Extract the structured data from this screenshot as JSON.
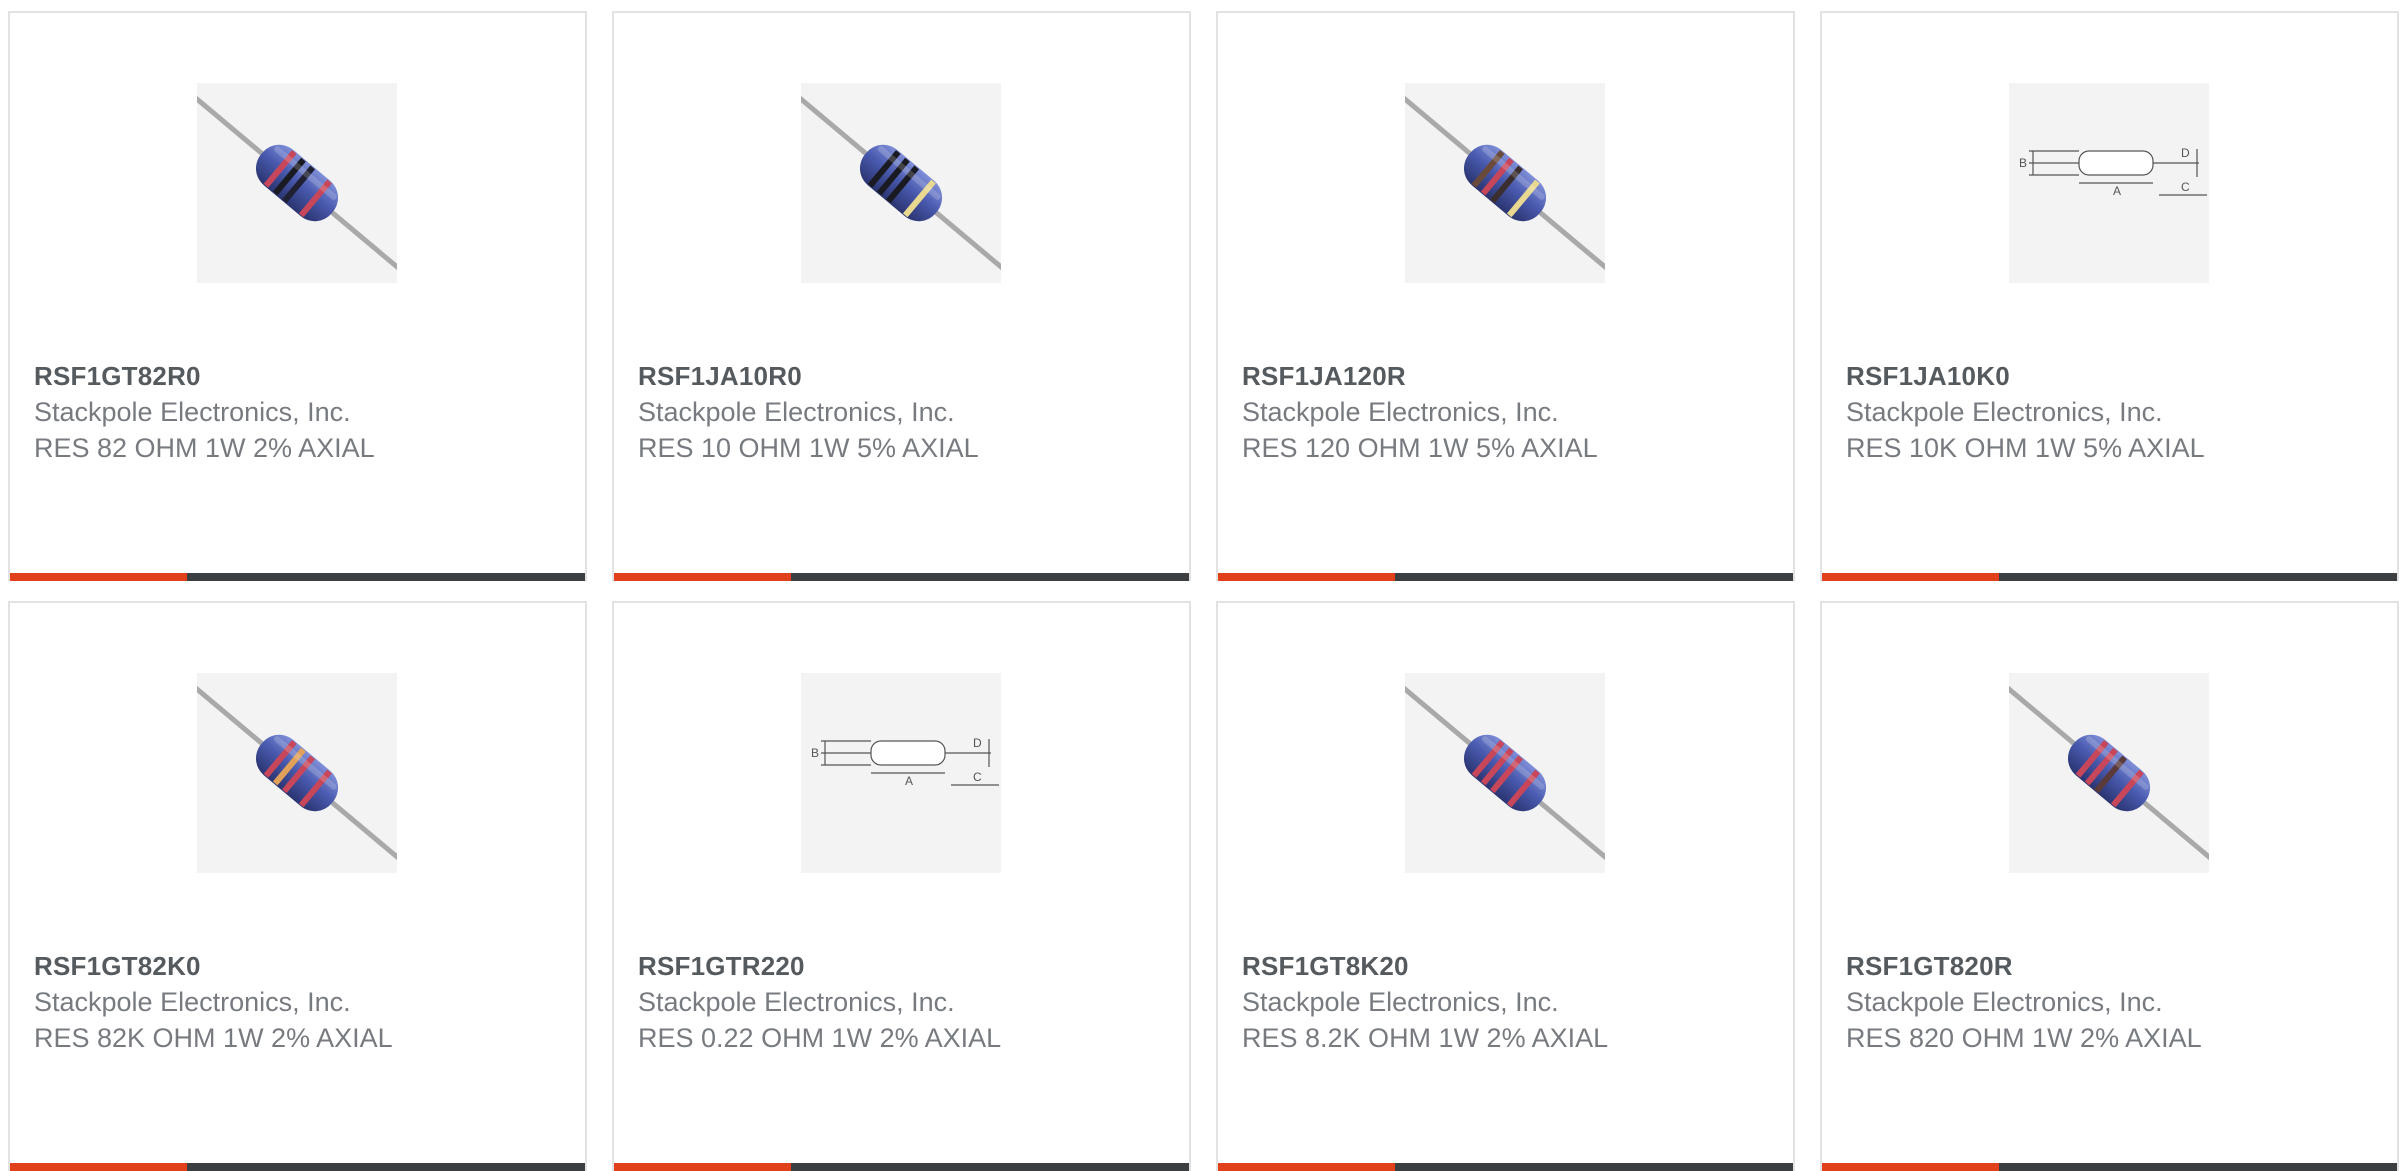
{
  "colors": {
    "accent": "#e0401a",
    "bar": "#3c3f42",
    "border": "#e2e2e2",
    "part_number": "#555a5e",
    "secondary_text": "#777b80"
  },
  "accent_fraction": 0.31,
  "products": [
    {
      "part_number": "RSF1GT82R0",
      "manufacturer": "Stackpole Electronics, Inc.",
      "description": "RES 82 OHM 1W 2% AXIAL",
      "image": "resistor-photo-icon",
      "bands": [
        "#c8465a",
        "#1a1a22",
        "#202033",
        "#c8465a"
      ]
    },
    {
      "part_number": "RSF1JA10R0",
      "manufacturer": "Stackpole Electronics, Inc.",
      "description": "RES 10 OHM 1W 5% AXIAL",
      "image": "resistor-photo-icon",
      "bands": [
        "#1a1a22",
        "#1a1a22",
        "#1a1a22",
        "#e8d890"
      ]
    },
    {
      "part_number": "RSF1JA120R",
      "manufacturer": "Stackpole Electronics, Inc.",
      "description": "RES 120 OHM 1W 5% AXIAL",
      "image": "resistor-photo-icon",
      "bands": [
        "#6a4a3a",
        "#c8465a",
        "#3a2e2e",
        "#e8d890"
      ]
    },
    {
      "part_number": "RSF1JA10K0",
      "manufacturer": "Stackpole Electronics, Inc.",
      "description": "RES 10K OHM 1W 5% AXIAL",
      "image": "dimension-drawing-icon",
      "bands": []
    },
    {
      "part_number": "RSF1GT82K0",
      "manufacturer": "Stackpole Electronics, Inc.",
      "description": "RES 82K OHM 1W 2% AXIAL",
      "image": "resistor-photo-icon",
      "bands": [
        "#c8465a",
        "#e0a05a",
        "#c8465a",
        "#c8465a"
      ]
    },
    {
      "part_number": "RSF1GTR220",
      "manufacturer": "Stackpole Electronics, Inc.",
      "description": "RES 0.22 OHM 1W 2% AXIAL",
      "image": "dimension-drawing-icon",
      "bands": []
    },
    {
      "part_number": "RSF1GT8K20",
      "manufacturer": "Stackpole Electronics, Inc.",
      "description": "RES 8.2K OHM 1W 2% AXIAL",
      "image": "resistor-photo-icon",
      "bands": [
        "#c8465a",
        "#c8465a",
        "#c8465a",
        "#c8465a"
      ]
    },
    {
      "part_number": "RSF1GT820R",
      "manufacturer": "Stackpole Electronics, Inc.",
      "description": "RES 820 OHM 1W 2% AXIAL",
      "image": "resistor-photo-icon",
      "bands": [
        "#c8465a",
        "#c8465a",
        "#5a3a3a",
        "#c8465a"
      ]
    }
  ],
  "diagram_labels": {
    "a": "A",
    "b": "B",
    "c": "C",
    "d": "D"
  }
}
